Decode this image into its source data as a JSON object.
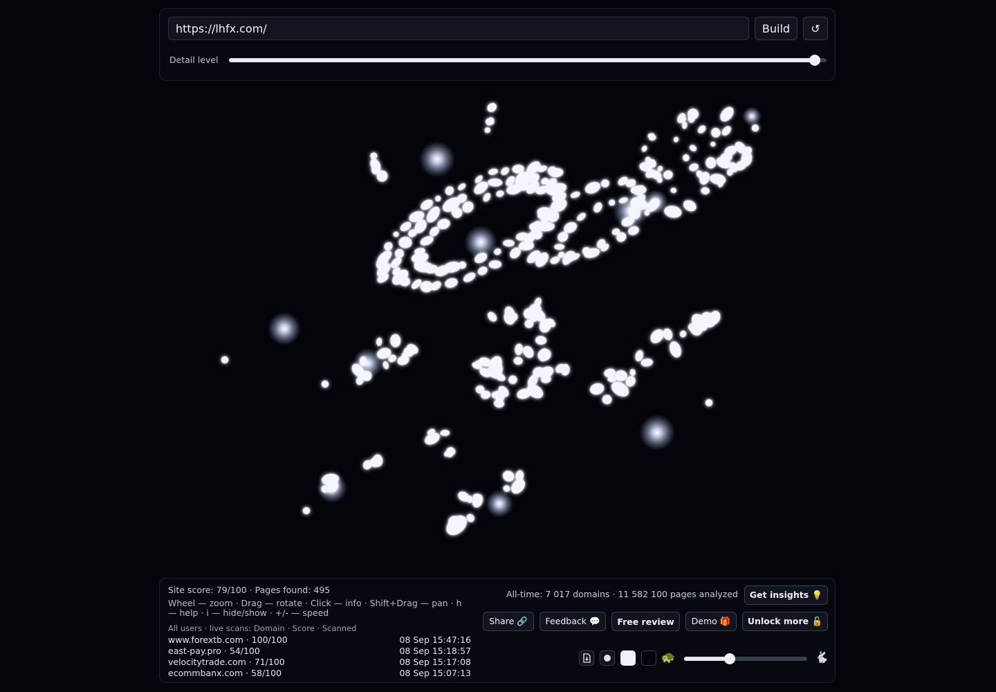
{
  "top": {
    "url_value": "https://lhfx.com/",
    "build_label": "Build",
    "reload_label": "↺",
    "detail_label": "Detail level",
    "detail_level": 0.98
  },
  "stats": {
    "score_line": "Site score: 79/100 · Pages found: 495",
    "help_text": "Wheel — zoom · Drag — rotate · Click — info · Shift+Drag — pan · h — help · i — hide/show · +/- — speed",
    "scans_header": "All users · live scans: Domain · Score · Scanned",
    "alltime": "All-time: 7 017 domains · 11 582 100 pages analyzed"
  },
  "scans": [
    {
      "domain": "www.forextb.com · 100/100",
      "time": "08 Sep 15:47:16"
    },
    {
      "domain": "east-pay.pro · 54/100",
      "time": "08 Sep 15:18:57"
    },
    {
      "domain": "velocitytrade.com · 71/100",
      "time": "08 Sep 15:17:08"
    },
    {
      "domain": "ecommbanx.com · 58/100",
      "time": "08 Sep 15:07:13"
    }
  ],
  "actions": {
    "insights": "Get insights 💡",
    "share": "Share 🔗",
    "feedback": "Feedback 💬",
    "free_review": "Free review",
    "demo": "Demo 🎁",
    "unlock": "Unlock more 🔓"
  },
  "controls": {
    "turtle_icon": "🐢",
    "rabbit_icon": "🐇",
    "speed": 0.37
  }
}
